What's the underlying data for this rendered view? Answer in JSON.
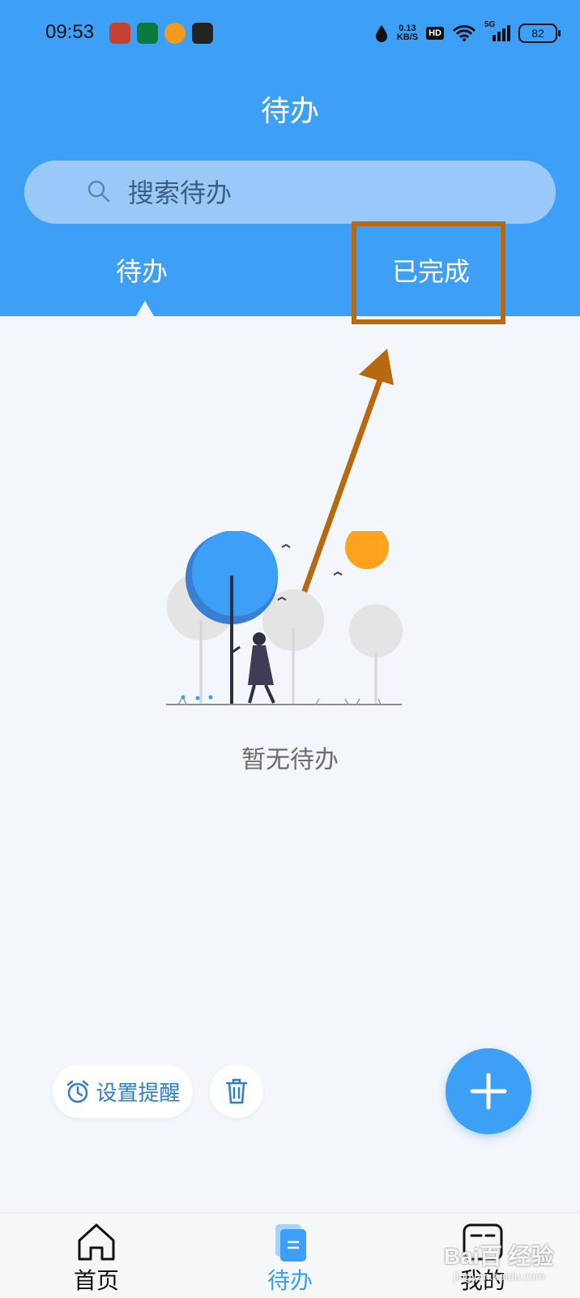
{
  "status_bar": {
    "time": "09:53",
    "net_speed_value": "0.13",
    "net_speed_unit": "KB/S",
    "hd": "HD",
    "signal": "5G",
    "battery": "82"
  },
  "header": {
    "title": "待办"
  },
  "search": {
    "placeholder": "搜索待办"
  },
  "tabs": [
    {
      "label": "待办",
      "active": true
    },
    {
      "label": "已完成",
      "active": false
    }
  ],
  "empty_state": {
    "text": "暂无待办"
  },
  "actions": {
    "reminder_label": "设置提醒"
  },
  "bottom_nav": [
    {
      "label": "首页",
      "icon": "home-icon",
      "active": false
    },
    {
      "label": "待办",
      "icon": "todo-icon",
      "active": true
    },
    {
      "label": "我的",
      "icon": "profile-icon",
      "active": false
    }
  ],
  "watermark": {
    "brand": "Bai百 经验",
    "url": "jingyan.baidu.com"
  },
  "colors": {
    "primary": "#3d9ff5",
    "background": "#f3f6fa",
    "annotation": "#b8690f",
    "sun": "#ffa21f",
    "inactive_nav": "#111111"
  }
}
